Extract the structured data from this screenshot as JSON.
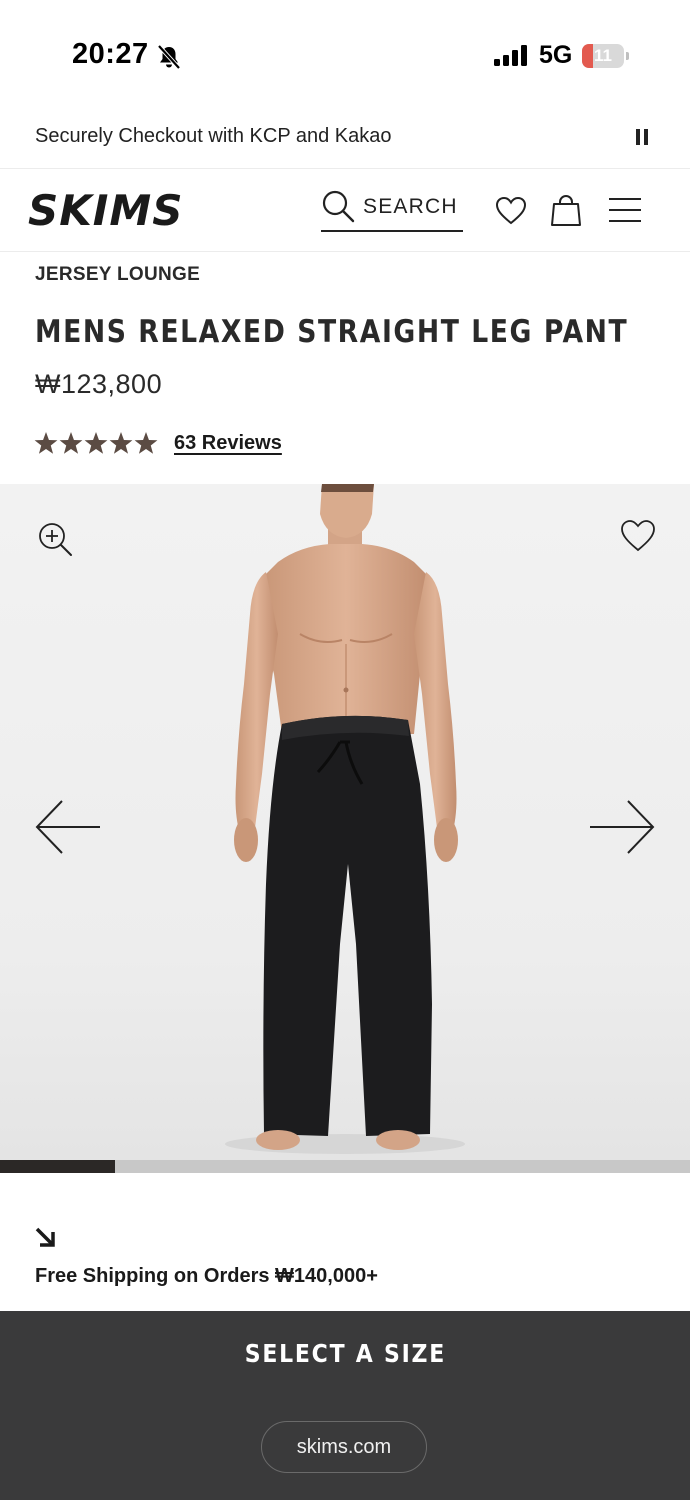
{
  "status_bar": {
    "time": "20:27",
    "network": "5G",
    "battery_level": "11",
    "battery_fraction": 0.11
  },
  "promo": {
    "text": "Securely Checkout with KCP and Kakao"
  },
  "header": {
    "logo_text": "SKIMS",
    "search_label": "SEARCH"
  },
  "product": {
    "collection": "JERSEY LOUNGE",
    "title": "MENS RELAXED STRAIGHT LEG PANT",
    "price": "₩123,800",
    "rating": 5,
    "reviews_label": "63 Reviews"
  },
  "gallery": {
    "progress_fraction": 0.167
  },
  "shipping": {
    "text": "Free Shipping on Orders ₩140,000+"
  },
  "bottom": {
    "select_size_label": "SELECT A SIZE",
    "url": "skims.com"
  },
  "colors": {
    "star": "#5b4b43",
    "bottom_panel": "#3a3a3b",
    "progress_fill": "#2b2826",
    "battery_low": "#e35a4f"
  },
  "icons": {
    "bell": "bell-slash-icon",
    "signal": "cellular-signal-icon",
    "search": "search-icon",
    "wishlist": "heart-icon",
    "bag": "shopping-bag-icon",
    "menu": "hamburger-menu-icon",
    "zoom": "zoom-in-icon",
    "prev": "arrow-left-icon",
    "next": "arrow-right-icon",
    "shipping": "arrow-down-right-icon"
  }
}
